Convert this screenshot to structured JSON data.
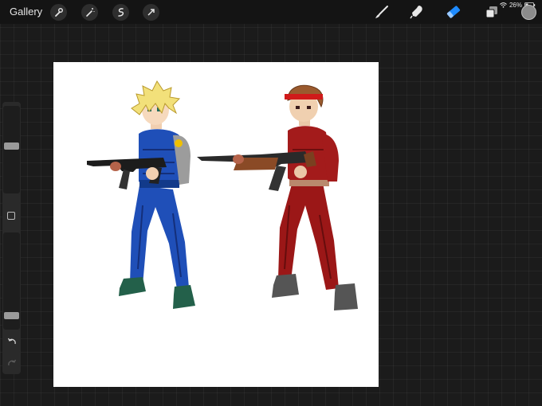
{
  "topbar": {
    "gallery_label": "Gallery",
    "tools": [
      "wrench-icon",
      "magic-wand-icon",
      "selection-icon",
      "transform-arrow-icon"
    ],
    "right_tools": [
      "brush-icon",
      "smudge-icon",
      "eraser-icon",
      "layers-icon"
    ],
    "active_tool": "eraser-icon",
    "accent_color": "#1e8bff"
  },
  "status_bar": {
    "battery": "26%"
  },
  "sidebar": {
    "brush_size_level": 0.55,
    "opacity_level": 0.1,
    "undo_icon": "undo-icon",
    "redo_icon": "redo-icon"
  },
  "colors": {
    "active_color": "#8c8c8c",
    "canvas": "#ffffff",
    "blue_character": "#1f4fb8",
    "red_character": "#a01a1a"
  }
}
